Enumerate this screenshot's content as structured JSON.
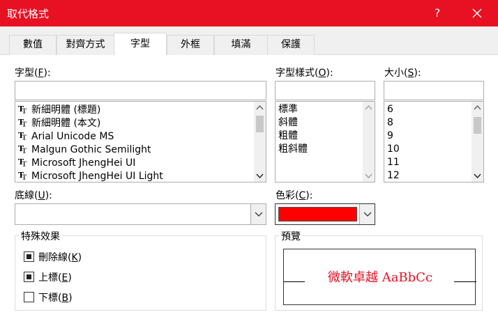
{
  "window": {
    "title": "取代格式",
    "help_label": "?",
    "accent": "#e81123"
  },
  "tabs": [
    {
      "label": "數值",
      "active": false
    },
    {
      "label": "對齊方式",
      "active": false
    },
    {
      "label": "字型",
      "active": true
    },
    {
      "label": "外框",
      "active": false
    },
    {
      "label": "填滿",
      "active": false
    },
    {
      "label": "保護",
      "active": false
    }
  ],
  "font": {
    "label": "字型(",
    "mnemonic": "F",
    "label_end": "):",
    "value": "",
    "items": [
      "新細明體 (標題)",
      "新細明體 (本文)",
      "Arial Unicode MS",
      "Malgun Gothic Semilight",
      "Microsoft JhengHei UI",
      "Microsoft JhengHei UI Light"
    ]
  },
  "font_style": {
    "label": "字型樣式(",
    "mnemonic": "O",
    "label_end": "):",
    "value": "",
    "items": [
      "標準",
      "斜體",
      "粗體",
      "粗斜體"
    ]
  },
  "size": {
    "label": "大小(",
    "mnemonic": "S",
    "label_end": "):",
    "value": "",
    "items": [
      "6",
      "8",
      "9",
      "10",
      "11",
      "12"
    ]
  },
  "underline": {
    "label": "底線(",
    "mnemonic": "U",
    "label_end": "):",
    "value": ""
  },
  "color": {
    "label": "色彩(",
    "mnemonic": "C",
    "label_end": "):",
    "swatch": "#ff0000"
  },
  "effects": {
    "group_label": "特殊效果",
    "items": [
      {
        "label": "刪除線(",
        "mnemonic": "K",
        "label_end": ")",
        "checked": true
      },
      {
        "label": "上標(",
        "mnemonic": "E",
        "label_end": ")",
        "checked": true
      },
      {
        "label": "下標(",
        "mnemonic": "B",
        "label_end": ")",
        "checked": false
      }
    ]
  },
  "preview": {
    "group_label": "預覽",
    "sample_text": "微軟卓越  AaBbCc"
  }
}
